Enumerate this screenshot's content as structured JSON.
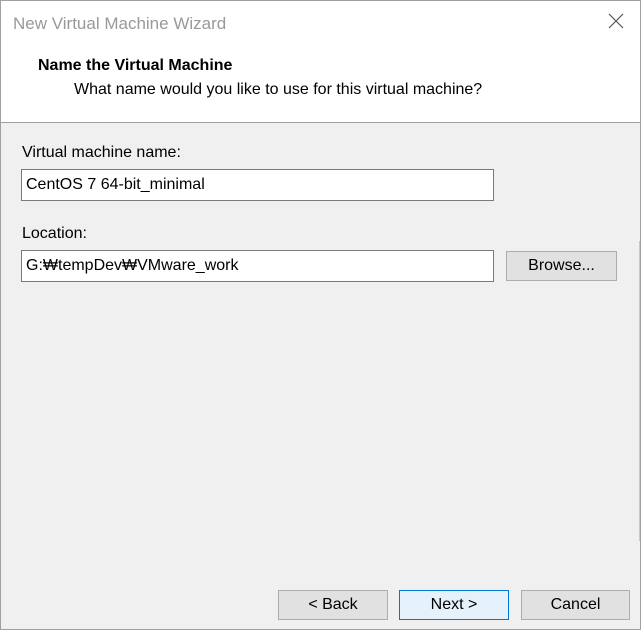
{
  "window": {
    "title": "New Virtual Machine Wizard",
    "close_icon": "close-icon"
  },
  "header": {
    "title": "Name the Virtual Machine",
    "subtitle": "What name would you like to use for this virtual machine?"
  },
  "form": {
    "vm_name_label": "Virtual machine name:",
    "vm_name_value": "CentOS 7 64-bit_minimal",
    "location_label": "Location:",
    "location_value": "G:₩tempDev₩VMware_work",
    "browse_label": "Browse..."
  },
  "footer": {
    "back_label": "< Back",
    "next_label": "Next >",
    "cancel_label": "Cancel"
  },
  "colors": {
    "default_button_border": "#0078d7",
    "default_button_bg": "#e5f1fb",
    "title_text": "#999999"
  }
}
